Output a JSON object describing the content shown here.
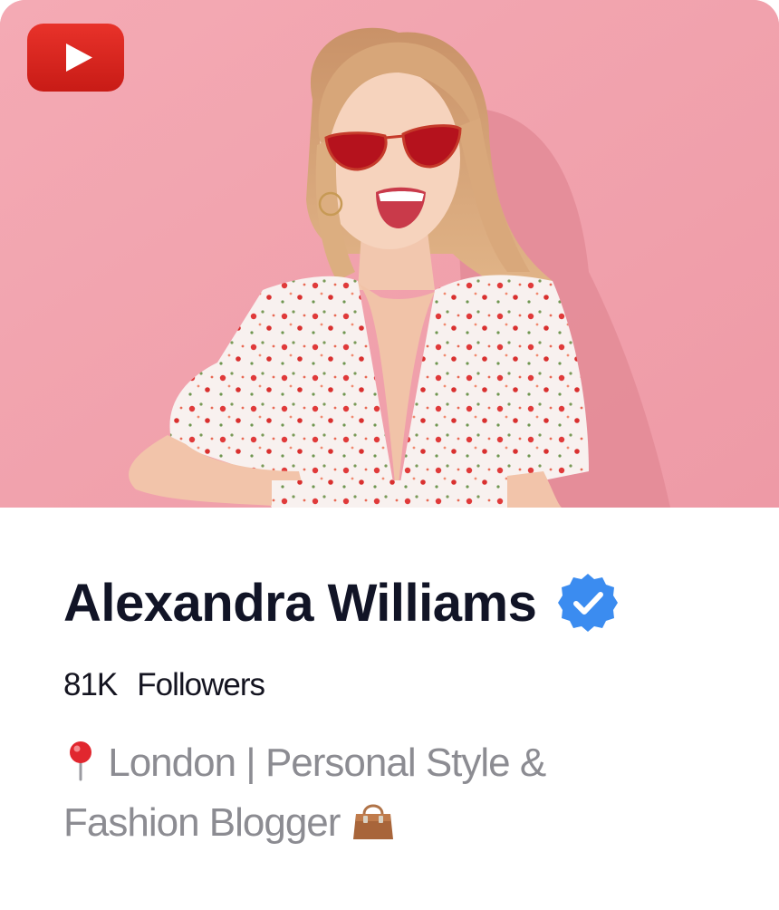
{
  "profile": {
    "name": "Alexandra Williams",
    "followers_count": "81K",
    "followers_label": "Followers",
    "bio_line1": "London | Personal Style &",
    "bio_line2": "Fashion Blogger",
    "location_icon": "round-pushpin-icon",
    "bag_icon": "handbag-icon",
    "verified_icon": "verified-badge-icon",
    "platform_icon": "youtube-logo-icon"
  },
  "colors": {
    "hero_background": "#f0a2ad",
    "youtube_red": "#e3221b",
    "verified_blue": "#3b8cf0",
    "name_text": "#111426",
    "bio_text": "#8c8c92"
  }
}
